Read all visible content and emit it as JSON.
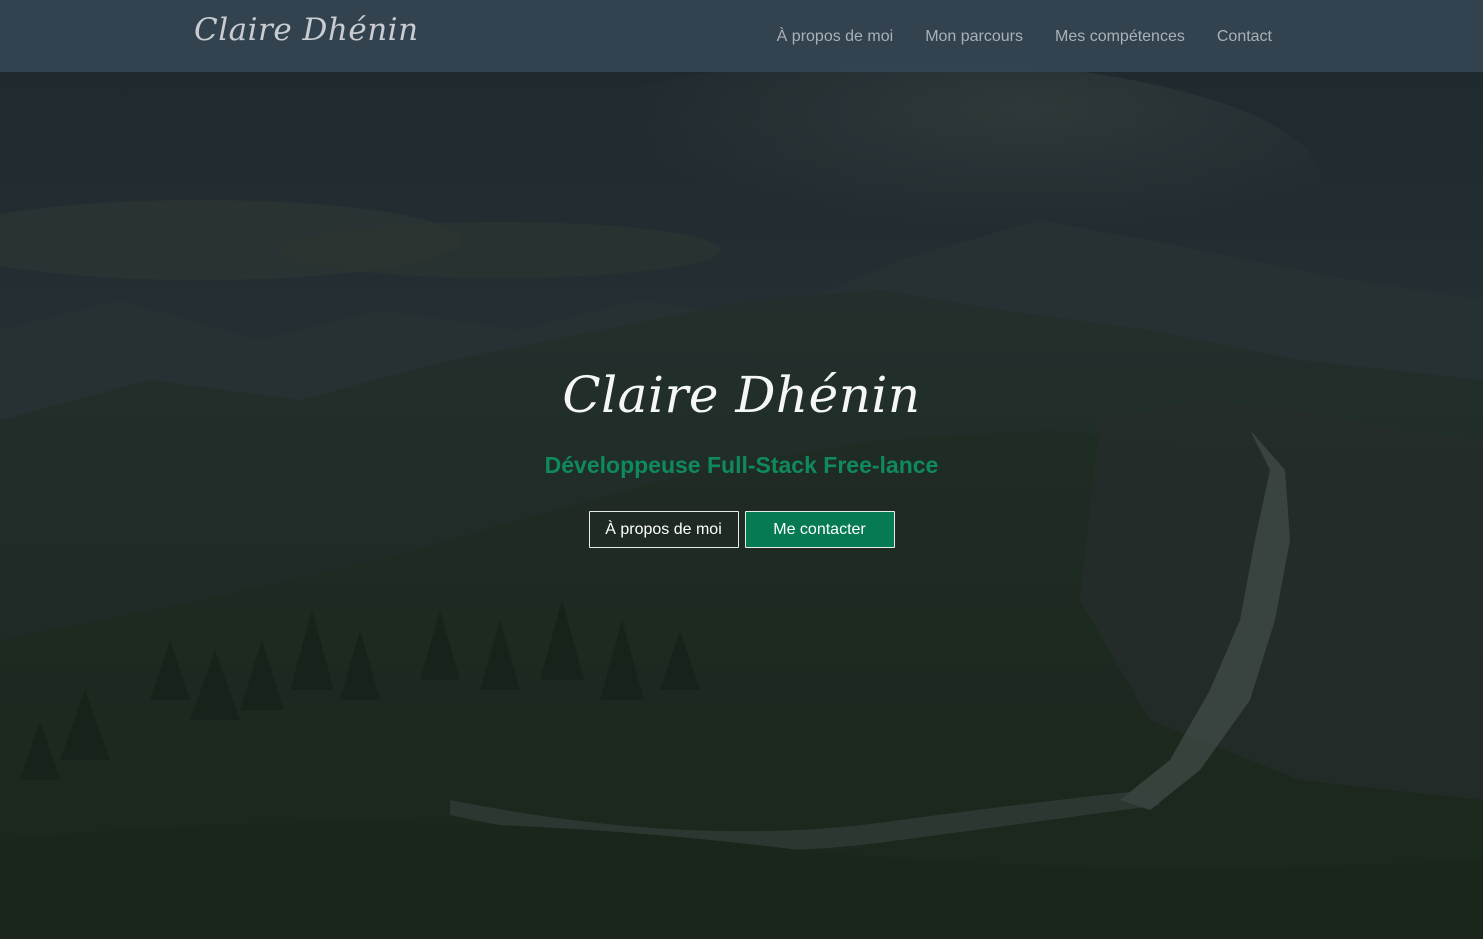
{
  "navbar": {
    "brand": "Claire Dhénin",
    "links": [
      {
        "label": "À propos de moi"
      },
      {
        "label": "Mon parcours"
      },
      {
        "label": "Mes compétences"
      },
      {
        "label": "Contact"
      }
    ]
  },
  "hero": {
    "title": "Claire Dhénin",
    "subtitle": "Développeuse Full-Stack Free-lance",
    "buttons": {
      "about_label": "À propos de moi",
      "contact_label": "Me contacter"
    }
  },
  "colors": {
    "accent": "#067a52",
    "subtitle": "#0f8a5c",
    "navbar_bg": "#344452"
  },
  "background": {
    "icon": "mountain-landscape-photo"
  }
}
